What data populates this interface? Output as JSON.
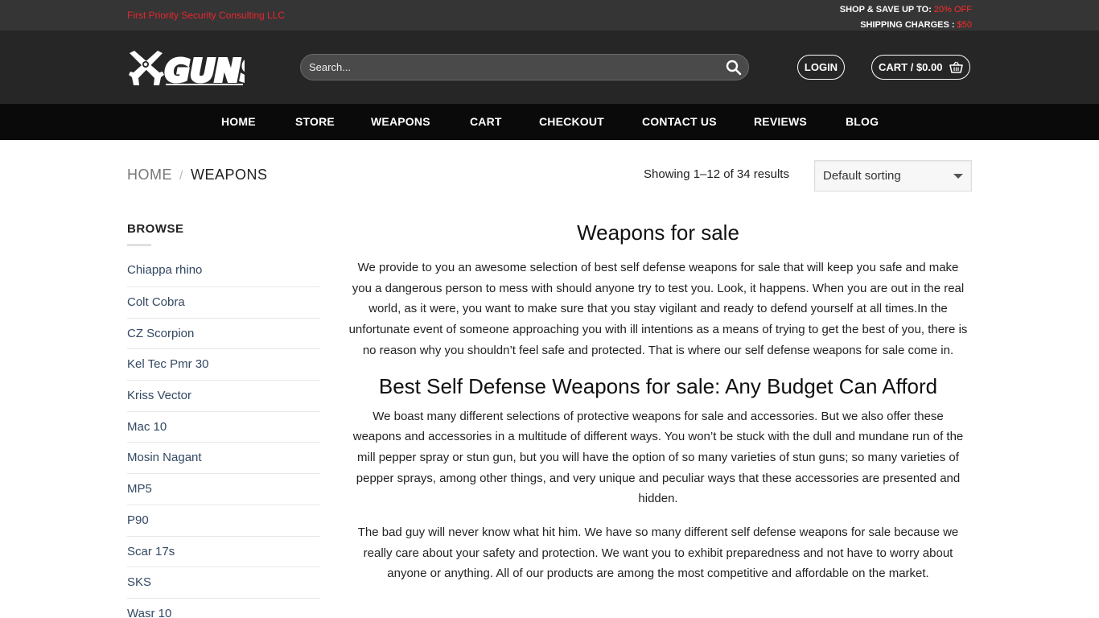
{
  "topbar": {
    "company": "First Priority Security Consulting LLC",
    "promo_line1_prefix": "SHOP & SAVE UP TO:",
    "promo_line1_highlight": "20% OFF",
    "promo_line2_prefix": "SHIPPING CHARGES :",
    "promo_line2_highlight": "$50"
  },
  "header": {
    "logo_text": "GUNS",
    "search_placeholder": "Search...",
    "login_label": "LOGIN",
    "cart_label": "CART / $0.00"
  },
  "nav": {
    "items": [
      "HOME",
      "STORE",
      "WEAPONS",
      "CART",
      "CHECKOUT",
      "CONTACT US",
      "REVIEWS",
      "BLOG"
    ]
  },
  "breadcrumb": {
    "home": "HOME",
    "separator": "/",
    "current": "WEAPONS"
  },
  "toolbar": {
    "results_text": "Showing 1–12 of 34 results",
    "sort_selected": "Default sorting"
  },
  "sidebar": {
    "title": "BROWSE",
    "items": [
      "Chiappa rhino",
      "Colt Cobra",
      "CZ Scorpion",
      "Kel Tec Pmr 30",
      "Kriss Vector",
      "Mac 10",
      "Mosin Nagant",
      "MP5",
      "P90",
      "Scar 17s",
      "SKS",
      "Wasr 10"
    ]
  },
  "content": {
    "heading": "Weapons for sale",
    "paragraph1": "We provide to you an awesome selection of best self defense weapons for sale that will keep you safe and make you a dangerous person to mess with should anyone try to test you. Look, it happens. When you are out in the real world, as it were, you want to make sure that you stay vigilant and ready to defend yourself at all times.In the unfortunate event of someone approaching you with ill intentions as a means of trying to get the best of you, there is no reason why you shouldn’t feel safe and protected. That is where our self defense weapons for sale come in.",
    "subheading": "Best Self Defense Weapons for sale: Any Budget Can Afford",
    "paragraph2": "We boast many different selections of protective weapons for sale and accessories. But we also offer these weapons and accessories in a multitude of different ways. You won’t be stuck with the dull and mundane run of the mill pepper spray or stun gun, but you will have the option of so many varieties of stun guns; so many varieties of pepper sprays, among other things, and very unique and peculiar ways that these accessories are presented and hidden.",
    "paragraph3": "The bad guy will never know what hit him. We have so many different self defense weapons for sale because we really care about your safety and protection. We want you to exhibit preparedness and not have to worry about anyone or anything. All of our products are among the most competitive and affordable on the market."
  },
  "colors": {
    "topbar_bg": "#353535",
    "header_bg": "#262626",
    "nav_bg": "#0a0a0a",
    "accent_red": "#e8262f",
    "link_blue": "#334862"
  },
  "icons": [
    "crossed-revolvers-logo-icon",
    "search-icon",
    "shopping-basket-icon",
    "dropdown-caret-icon"
  ]
}
